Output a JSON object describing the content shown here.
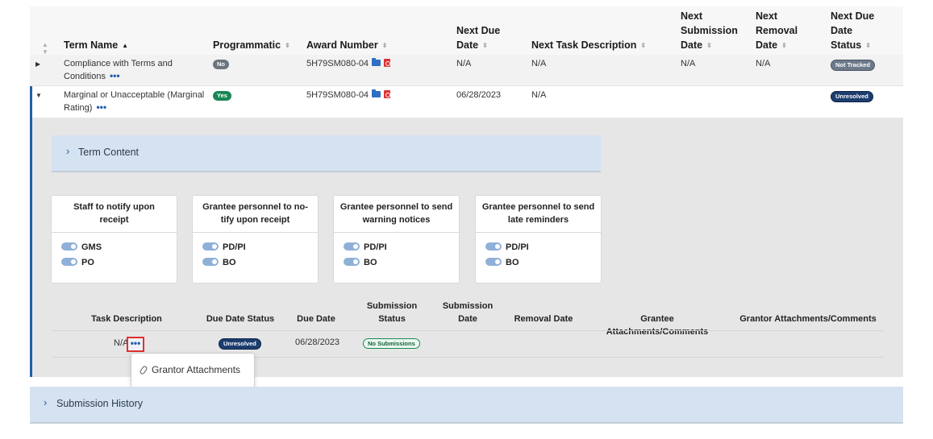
{
  "columns": {
    "term_name": "Term Name",
    "programmatic": "Programmatic",
    "award_number": "Award Number",
    "next_due_date": [
      "Next Due",
      "Date"
    ],
    "next_task_description": "Next Task Description",
    "next_submission_date": [
      "Next",
      "Submission",
      "Date"
    ],
    "next_removal_date": [
      "Next",
      "Removal",
      "Date"
    ],
    "next_due_date_status": [
      "Next Due",
      "Date",
      "Status"
    ]
  },
  "rows": [
    {
      "term_name": [
        "Compliance with Terms and",
        "Conditions"
      ],
      "programmatic": "No",
      "award_number": "5H79SM080-04",
      "next_due_date": "N/A",
      "next_task_description": "N/A",
      "next_submission_date": "N/A",
      "next_removal_date": "N/A",
      "status": "Not Tracked"
    },
    {
      "term_name": [
        "Marginal or Unacceptable (Marginal",
        "Rating)"
      ],
      "programmatic": "Yes",
      "award_number": "5H79SM080-04",
      "next_due_date": "06/28/2023",
      "next_task_description": "N/A",
      "next_submission_date": "",
      "next_removal_date": "",
      "status": "Unresolved"
    }
  ],
  "term_content_label": "Term Content",
  "cards": [
    {
      "title": [
        "Staff to notify upon",
        "receipt"
      ],
      "toggles": [
        "GMS",
        "PO"
      ]
    },
    {
      "title": [
        "Grantee personnel to no-",
        "tify upon receipt"
      ],
      "toggles": [
        "PD/PI",
        "BO"
      ]
    },
    {
      "title": [
        "Grantee personnel to send",
        "warning notices"
      ],
      "toggles": [
        "PD/PI",
        "BO"
      ]
    },
    {
      "title": [
        "Grantee personnel to send",
        "late reminders"
      ],
      "toggles": [
        "PD/PI",
        "BO"
      ]
    }
  ],
  "task_columns": {
    "task_description": "Task Description",
    "due_date_status": "Due Date Status",
    "due_date": "Due Date",
    "submission_status": [
      "Submission",
      "Status"
    ],
    "submission_date": [
      "Submission",
      "Date"
    ],
    "removal_date": "Removal Date",
    "grantee_attachments": "Grantee Attachments/Comments",
    "grantor_attachments": "Grantor Attachments/Comments"
  },
  "task_row": {
    "task_description": "N/A",
    "due_date_status": "Unresolved",
    "due_date": "06/28/2023",
    "submission_status": "No Submissions"
  },
  "menu": {
    "item": "Grantor Attachments"
  },
  "submission_history_label": "Submission History",
  "more_glyph": "•••",
  "colors": {
    "accent": "#1f5fa8",
    "panel": "#d5e2f1",
    "success": "#198754",
    "navy_badge": "#1c3d6e",
    "highlight": "#e03030"
  }
}
